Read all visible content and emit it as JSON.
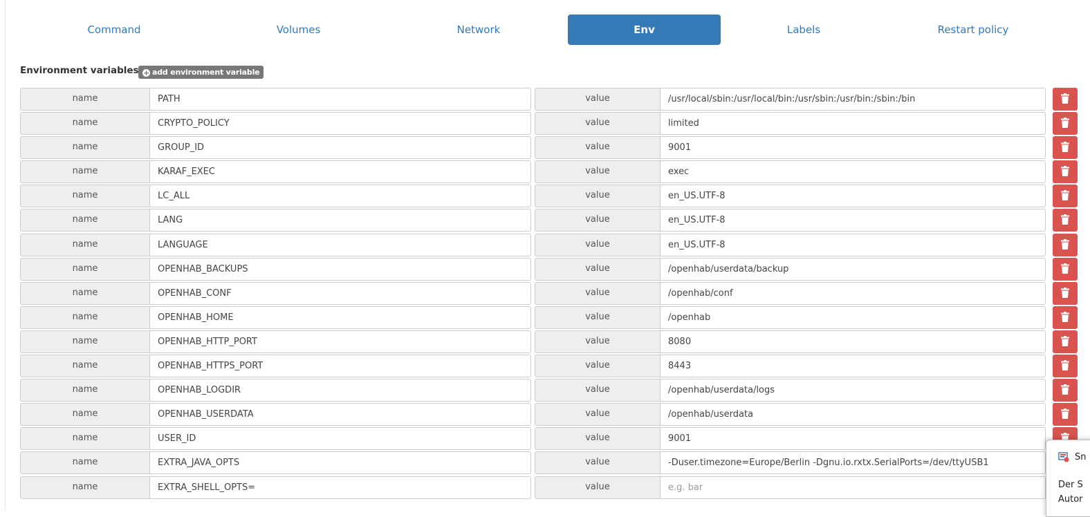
{
  "tabs": [
    {
      "label": "Command",
      "active": false
    },
    {
      "label": "Volumes",
      "active": false
    },
    {
      "label": "Network",
      "active": false
    },
    {
      "label": "Env",
      "active": true
    },
    {
      "label": "Labels",
      "active": false
    },
    {
      "label": "Restart policy",
      "active": false
    }
  ],
  "env": {
    "title": "Environment variables",
    "add_label": "add environment variable",
    "name_label": "name",
    "value_label": "value",
    "value_placeholder": "e.g. bar",
    "vars": [
      {
        "name": "PATH",
        "value": "/usr/local/sbin:/usr/local/bin:/usr/sbin:/usr/bin:/sbin:/bin"
      },
      {
        "name": "CRYPTO_POLICY",
        "value": "limited"
      },
      {
        "name": "GROUP_ID",
        "value": "9001"
      },
      {
        "name": "KARAF_EXEC",
        "value": "exec"
      },
      {
        "name": "LC_ALL",
        "value": "en_US.UTF-8"
      },
      {
        "name": "LANG",
        "value": "en_US.UTF-8"
      },
      {
        "name": "LANGUAGE",
        "value": "en_US.UTF-8"
      },
      {
        "name": "OPENHAB_BACKUPS",
        "value": "/openhab/userdata/backup"
      },
      {
        "name": "OPENHAB_CONF",
        "value": "/openhab/conf"
      },
      {
        "name": "OPENHAB_HOME",
        "value": "/openhab"
      },
      {
        "name": "OPENHAB_HTTP_PORT",
        "value": "8080"
      },
      {
        "name": "OPENHAB_HTTPS_PORT",
        "value": "8443"
      },
      {
        "name": "OPENHAB_LOGDIR",
        "value": "/openhab/userdata/logs"
      },
      {
        "name": "OPENHAB_USERDATA",
        "value": "/openhab/userdata"
      },
      {
        "name": "USER_ID",
        "value": "9001"
      },
      {
        "name": "EXTRA_JAVA_OPTS",
        "value": "-Duser.timezone=Europe/Berlin -Dgnu.io.rxtx.SerialPorts=/dev/ttyUSB1"
      },
      {
        "name": "EXTRA_SHELL_OPTS=",
        "value": ""
      }
    ]
  },
  "toast": {
    "title": "Sn",
    "line1": "Der S",
    "line2": "Autor"
  },
  "colors": {
    "accent": "#337ab7",
    "danger": "#d9534f",
    "badge": "#777777"
  },
  "icons": {
    "delete": "trash-icon",
    "add": "plus-circle-icon",
    "toast": "app-icon"
  }
}
